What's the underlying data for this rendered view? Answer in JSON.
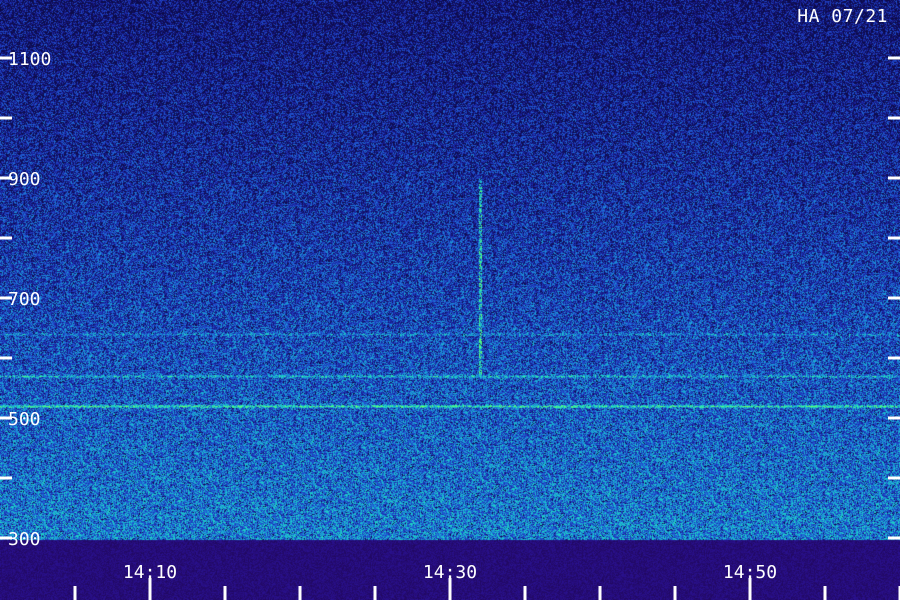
{
  "station_label": "HA 07/21",
  "chart_data": {
    "type": "heatmap",
    "title": "",
    "xlabel": "",
    "ylabel": "",
    "y_unit": "",
    "ylim": [
      300,
      1100
    ],
    "y_ticks": [
      {
        "value": 300,
        "label": "300"
      },
      {
        "value": 500,
        "label": "500"
      },
      {
        "value": 700,
        "label": "700"
      },
      {
        "value": 900,
        "label": "900"
      },
      {
        "value": 1100,
        "label": "1100"
      }
    ],
    "y_minor_ticks": [
      400,
      600,
      800,
      1000
    ],
    "x_range": [
      "14:05",
      "15:00"
    ],
    "x_ticks": [
      {
        "value": "14:10",
        "label": "14:10"
      },
      {
        "value": "14:30",
        "label": "14:30"
      },
      {
        "value": "14:50",
        "label": "14:50"
      }
    ],
    "x_minor_ticks": [
      "14:05",
      "14:15",
      "14:20",
      "14:25",
      "14:35",
      "14:40",
      "14:45",
      "14:55",
      "15:00"
    ],
    "colormap": [
      "#0d0b4a",
      "#1a1f9a",
      "#2050d0",
      "#1aa0d8",
      "#20e0c0",
      "#60ff70"
    ],
    "features": [
      {
        "kind": "horizontal_line",
        "y": 520,
        "strength": 0.9
      },
      {
        "kind": "horizontal_line",
        "y": 570,
        "strength": 0.55
      },
      {
        "kind": "horizontal_line",
        "y": 640,
        "strength": 0.35
      },
      {
        "kind": "burst",
        "time": "14:32",
        "y_from": 570,
        "y_to": 900
      }
    ]
  }
}
